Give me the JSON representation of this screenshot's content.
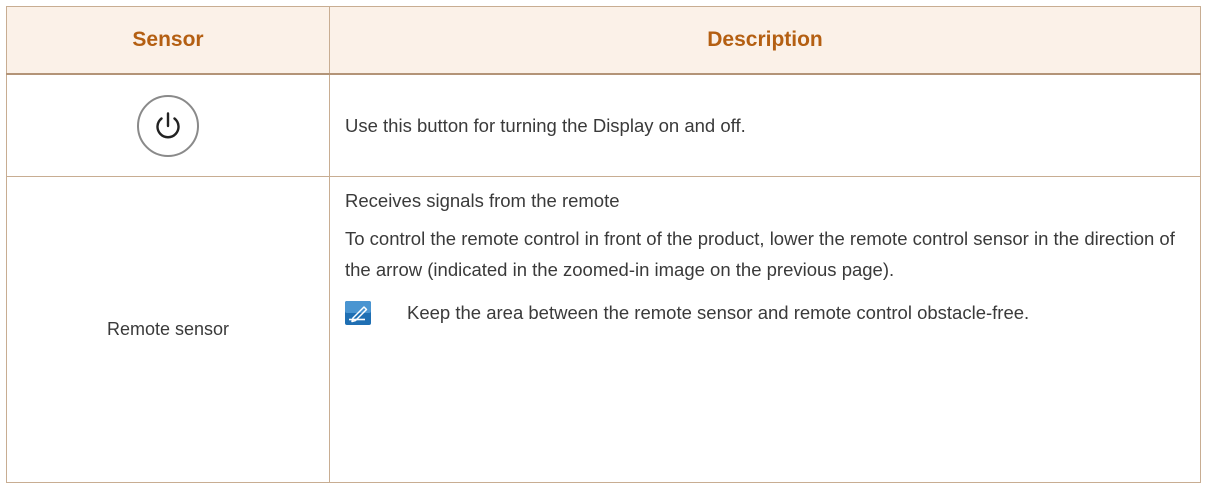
{
  "table": {
    "header": {
      "sensor": "Sensor",
      "description": "Description"
    },
    "rows": [
      {
        "sensor_icon": "power-icon",
        "description": "Use this button for turning the Display on and off."
      },
      {
        "sensor": "Remote sensor",
        "description_lines": [
          "Receives signals from the remote",
          "To control the remote control in front of the product, lower the remote control sensor in the direction of the arrow (indicated in the zoomed-in image on the previous page)."
        ],
        "note_icon": "pencil-note-icon",
        "note": "Keep the area between the remote sensor and remote control obstacle-free."
      }
    ]
  },
  "colors": {
    "header_text": "#b45f12",
    "header_bg": "#fbf1e8",
    "border": "#c8ad92",
    "note_icon_bg": "#1f6fb3"
  }
}
